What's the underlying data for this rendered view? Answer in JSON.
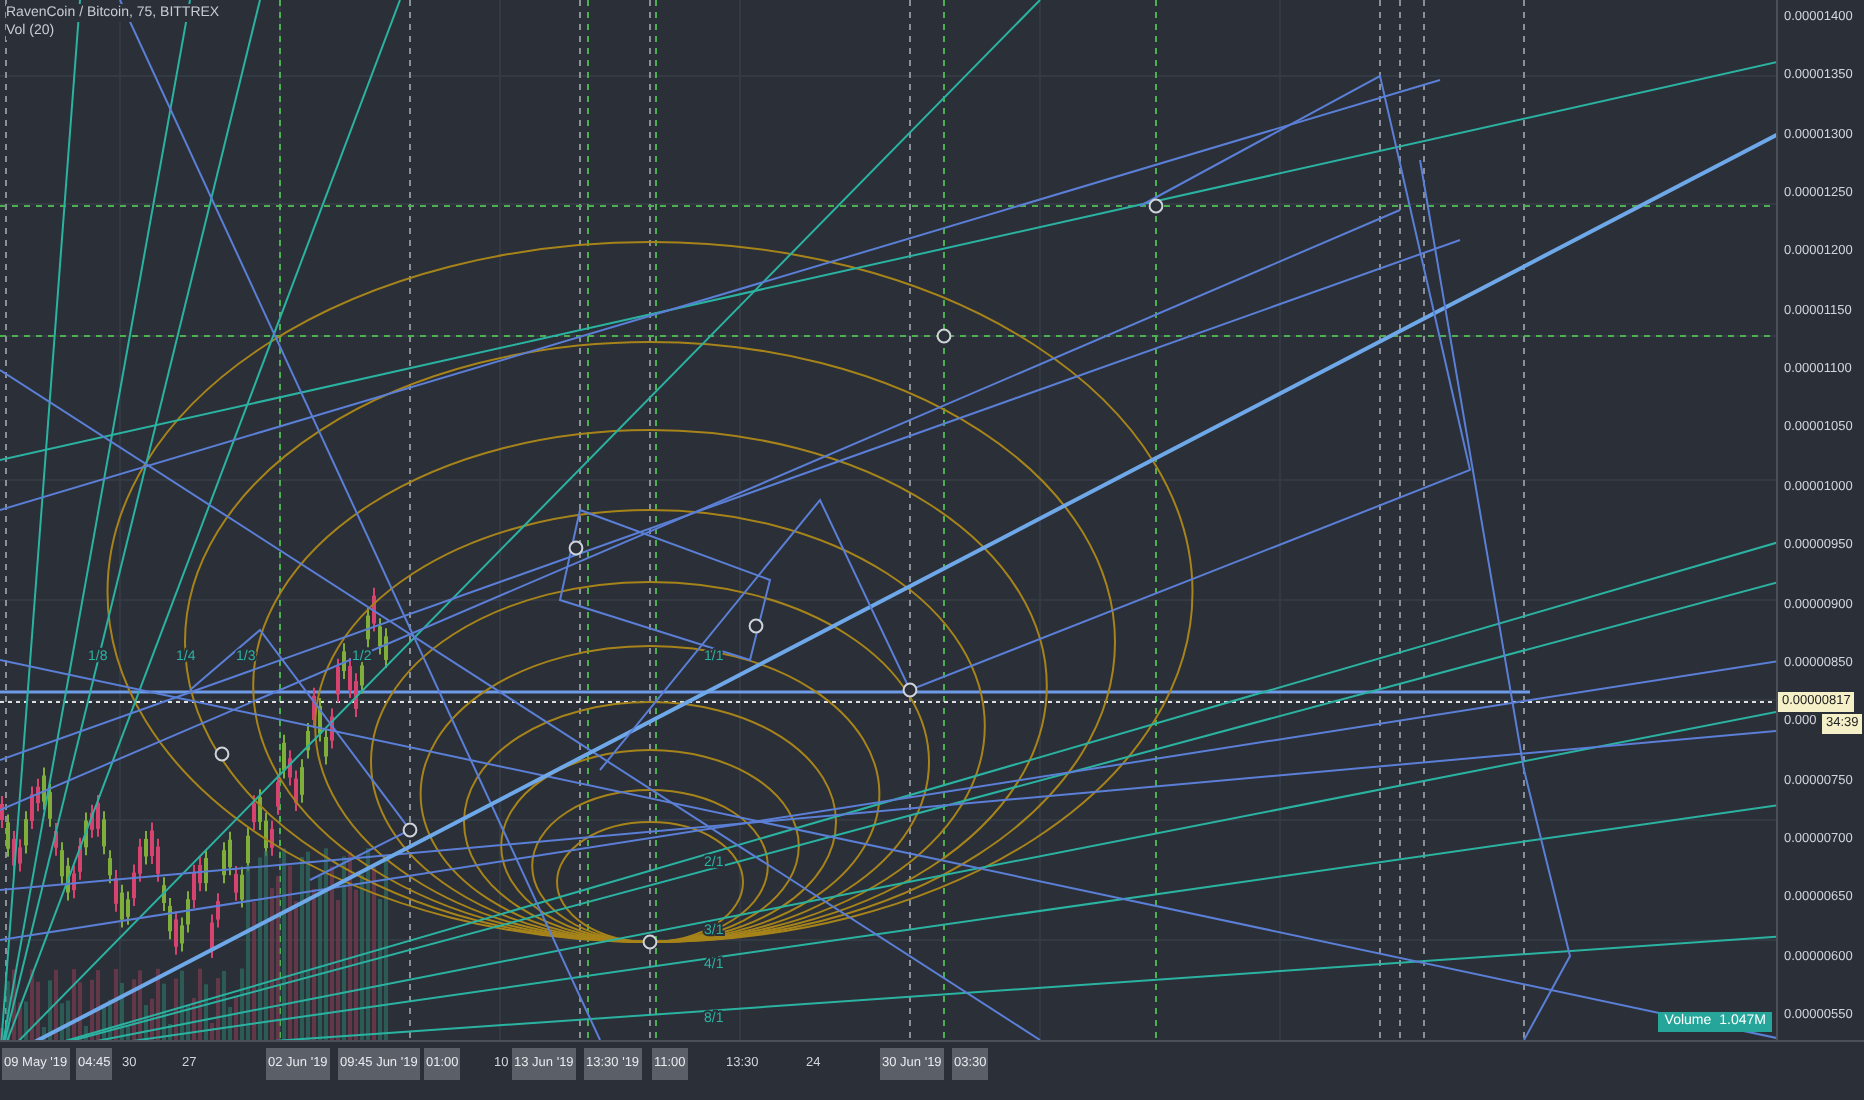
{
  "legend": {
    "symbol": "RavenCoin / Bitcoin, 75, BITTREX",
    "indicator": "Vol (20)"
  },
  "price_axis": [
    "0.00001400",
    "0.00001350",
    "0.00001300",
    "0.00001250",
    "0.00001200",
    "0.00001150",
    "0.00001100",
    "0.00001050",
    "0.00001000",
    "0.00000950",
    "0.00000900",
    "0.00000850",
    "0.000",
    "0.00000750",
    "0.00000700",
    "0.00000650",
    "0.00000600",
    "0.00000550"
  ],
  "last_price": {
    "price": "0.00000817",
    "countdown": "34:39"
  },
  "time_axis": [
    {
      "label": "09 May '19",
      "highlighted": true
    },
    {
      "label": "04:45",
      "highlighted": true
    },
    {
      "label": "30",
      "highlighted": false
    },
    {
      "label": "27",
      "highlighted": false
    },
    {
      "label": "02 Jun '19",
      "highlighted": true
    },
    {
      "label": "09:45 Jun '19",
      "highlighted": true
    },
    {
      "label": "01:00",
      "highlighted": true
    },
    {
      "label": "10",
      "highlighted": false
    },
    {
      "label": "13 Jun '19",
      "highlighted": true
    },
    {
      "label": "13:30 '19",
      "highlighted": true
    },
    {
      "label": "11:00",
      "highlighted": true
    },
    {
      "label": "13:30",
      "highlighted": false
    },
    {
      "label": "24",
      "highlighted": false
    },
    {
      "label": "30 Jun '19",
      "highlighted": true
    },
    {
      "label": "03:30",
      "highlighted": true
    }
  ],
  "fan_labels": [
    "1/8",
    "1/4",
    "1/3",
    "1/2",
    "1/1",
    "2/1",
    "3/1",
    "4/1",
    "8/1"
  ],
  "volume_badge": {
    "label": "Volume",
    "value": "1.047M"
  }
}
